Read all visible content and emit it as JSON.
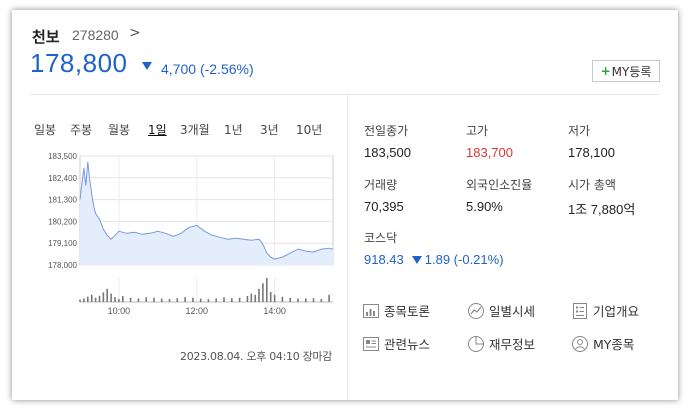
{
  "header": {
    "name": "천보",
    "code": "278280",
    "code_chevron": ">",
    "price": "178,800",
    "change": "4,700",
    "change_pct": "(-2.56%)",
    "my_button": "MY등록",
    "my_button_plus": "+"
  },
  "tabs": [
    {
      "label": "일봉",
      "active": false
    },
    {
      "label": "주봉",
      "active": false
    },
    {
      "label": "월봉",
      "active": false
    },
    {
      "label": "1일",
      "active": true
    },
    {
      "label": "3개월",
      "active": false
    },
    {
      "label": "1년",
      "active": false
    },
    {
      "label": "3년",
      "active": false
    },
    {
      "label": "10년",
      "active": false
    }
  ],
  "chart_data": {
    "type": "area",
    "y_ticks": [
      "183,500",
      "182,400",
      "181,300",
      "180,200",
      "179,100",
      "178,000"
    ],
    "y_tick_values": [
      183500,
      182400,
      181300,
      180200,
      179100,
      178000
    ],
    "ylim": [
      178000,
      183500
    ],
    "x_ticks": [
      "10:00",
      "12:00",
      "14:00"
    ],
    "x_tick_hours": [
      10,
      12,
      14
    ],
    "xlim": [
      9,
      15.5
    ],
    "grid": true,
    "line_color": "#7a9ad8",
    "fill_color": "#e3edfb",
    "price_series": [
      [
        9.0,
        181300
      ],
      [
        9.05,
        182100
      ],
      [
        9.1,
        182900
      ],
      [
        9.15,
        182000
      ],
      [
        9.2,
        183200
      ],
      [
        9.25,
        182300
      ],
      [
        9.3,
        181600
      ],
      [
        9.35,
        181000
      ],
      [
        9.4,
        180600
      ],
      [
        9.5,
        180300
      ],
      [
        9.6,
        179800
      ],
      [
        9.7,
        179500
      ],
      [
        9.8,
        179300
      ],
      [
        9.9,
        179500
      ],
      [
        10.0,
        179700
      ],
      [
        10.2,
        179600
      ],
      [
        10.4,
        179650
      ],
      [
        10.6,
        179550
      ],
      [
        10.8,
        179600
      ],
      [
        11.0,
        179700
      ],
      [
        11.2,
        179600
      ],
      [
        11.4,
        179450
      ],
      [
        11.6,
        179600
      ],
      [
        11.8,
        179900
      ],
      [
        12.0,
        180000
      ],
      [
        12.2,
        179700
      ],
      [
        12.4,
        179500
      ],
      [
        12.6,
        179400
      ],
      [
        12.8,
        179300
      ],
      [
        13.0,
        179350
      ],
      [
        13.2,
        179300
      ],
      [
        13.4,
        179250
      ],
      [
        13.6,
        179300
      ],
      [
        13.7,
        179050
      ],
      [
        13.8,
        178600
      ],
      [
        13.9,
        178400
      ],
      [
        14.0,
        178300
      ],
      [
        14.2,
        178400
      ],
      [
        14.4,
        178600
      ],
      [
        14.6,
        178800
      ],
      [
        14.8,
        178700
      ],
      [
        15.0,
        178650
      ],
      [
        15.2,
        178800
      ],
      [
        15.4,
        178850
      ],
      [
        15.5,
        178800
      ]
    ],
    "volume_series": [
      [
        9.0,
        0.1
      ],
      [
        9.1,
        0.15
      ],
      [
        9.2,
        0.22
      ],
      [
        9.3,
        0.3
      ],
      [
        9.4,
        0.18
      ],
      [
        9.5,
        0.26
      ],
      [
        9.6,
        0.4
      ],
      [
        9.7,
        0.55
      ],
      [
        9.8,
        0.35
      ],
      [
        9.9,
        0.2
      ],
      [
        10.0,
        0.12
      ],
      [
        10.1,
        0.25
      ],
      [
        10.3,
        0.18
      ],
      [
        10.5,
        0.15
      ],
      [
        10.7,
        0.2
      ],
      [
        10.9,
        0.18
      ],
      [
        11.1,
        0.14
      ],
      [
        11.3,
        0.12
      ],
      [
        11.5,
        0.16
      ],
      [
        11.7,
        0.2
      ],
      [
        11.9,
        0.18
      ],
      [
        12.1,
        0.14
      ],
      [
        12.3,
        0.12
      ],
      [
        12.5,
        0.15
      ],
      [
        12.7,
        0.2
      ],
      [
        12.9,
        0.16
      ],
      [
        13.1,
        0.18
      ],
      [
        13.3,
        0.25
      ],
      [
        13.4,
        0.35
      ],
      [
        13.5,
        0.3
      ],
      [
        13.6,
        0.55
      ],
      [
        13.7,
        0.78
      ],
      [
        13.8,
        1.0
      ],
      [
        13.9,
        0.42
      ],
      [
        14.0,
        0.3
      ],
      [
        14.2,
        0.22
      ],
      [
        14.4,
        0.18
      ],
      [
        14.6,
        0.14
      ],
      [
        14.8,
        0.15
      ],
      [
        15.0,
        0.16
      ],
      [
        15.2,
        0.12
      ],
      [
        15.4,
        0.3
      ]
    ]
  },
  "timestamp": "2023.08.04. 오후 04:10 장마감",
  "stats": {
    "prev_close": {
      "label": "전일종가",
      "value": "183,500"
    },
    "high": {
      "label": "고가",
      "value": "183,700"
    },
    "low": {
      "label": "저가",
      "value": "178,100"
    },
    "volume": {
      "label": "거래량",
      "value": "70,395"
    },
    "foreign": {
      "label": "외국인소진율",
      "value": "5.90%"
    },
    "market_cap": {
      "label": "시가 총액",
      "value": "1조 7,880억"
    },
    "index": {
      "label": "코스닥",
      "value": "918.43",
      "change": "1.89 (-0.21%)"
    }
  },
  "links": {
    "discussion": {
      "label": "종목토론",
      "icon": "discussion-chart-icon"
    },
    "daily": {
      "label": "일별시세",
      "icon": "trend-circle-icon"
    },
    "company": {
      "label": "기업개요",
      "icon": "document-icon"
    },
    "news": {
      "label": "관련뉴스",
      "icon": "news-icon"
    },
    "finance": {
      "label": "재무정보",
      "icon": "pie-chart-icon"
    },
    "my": {
      "label": "MY종목",
      "icon": "user-icon"
    }
  },
  "colors": {
    "accent_blue": "#1f63c9",
    "up_red": "#d93636",
    "plus_green": "#2aa53a"
  }
}
